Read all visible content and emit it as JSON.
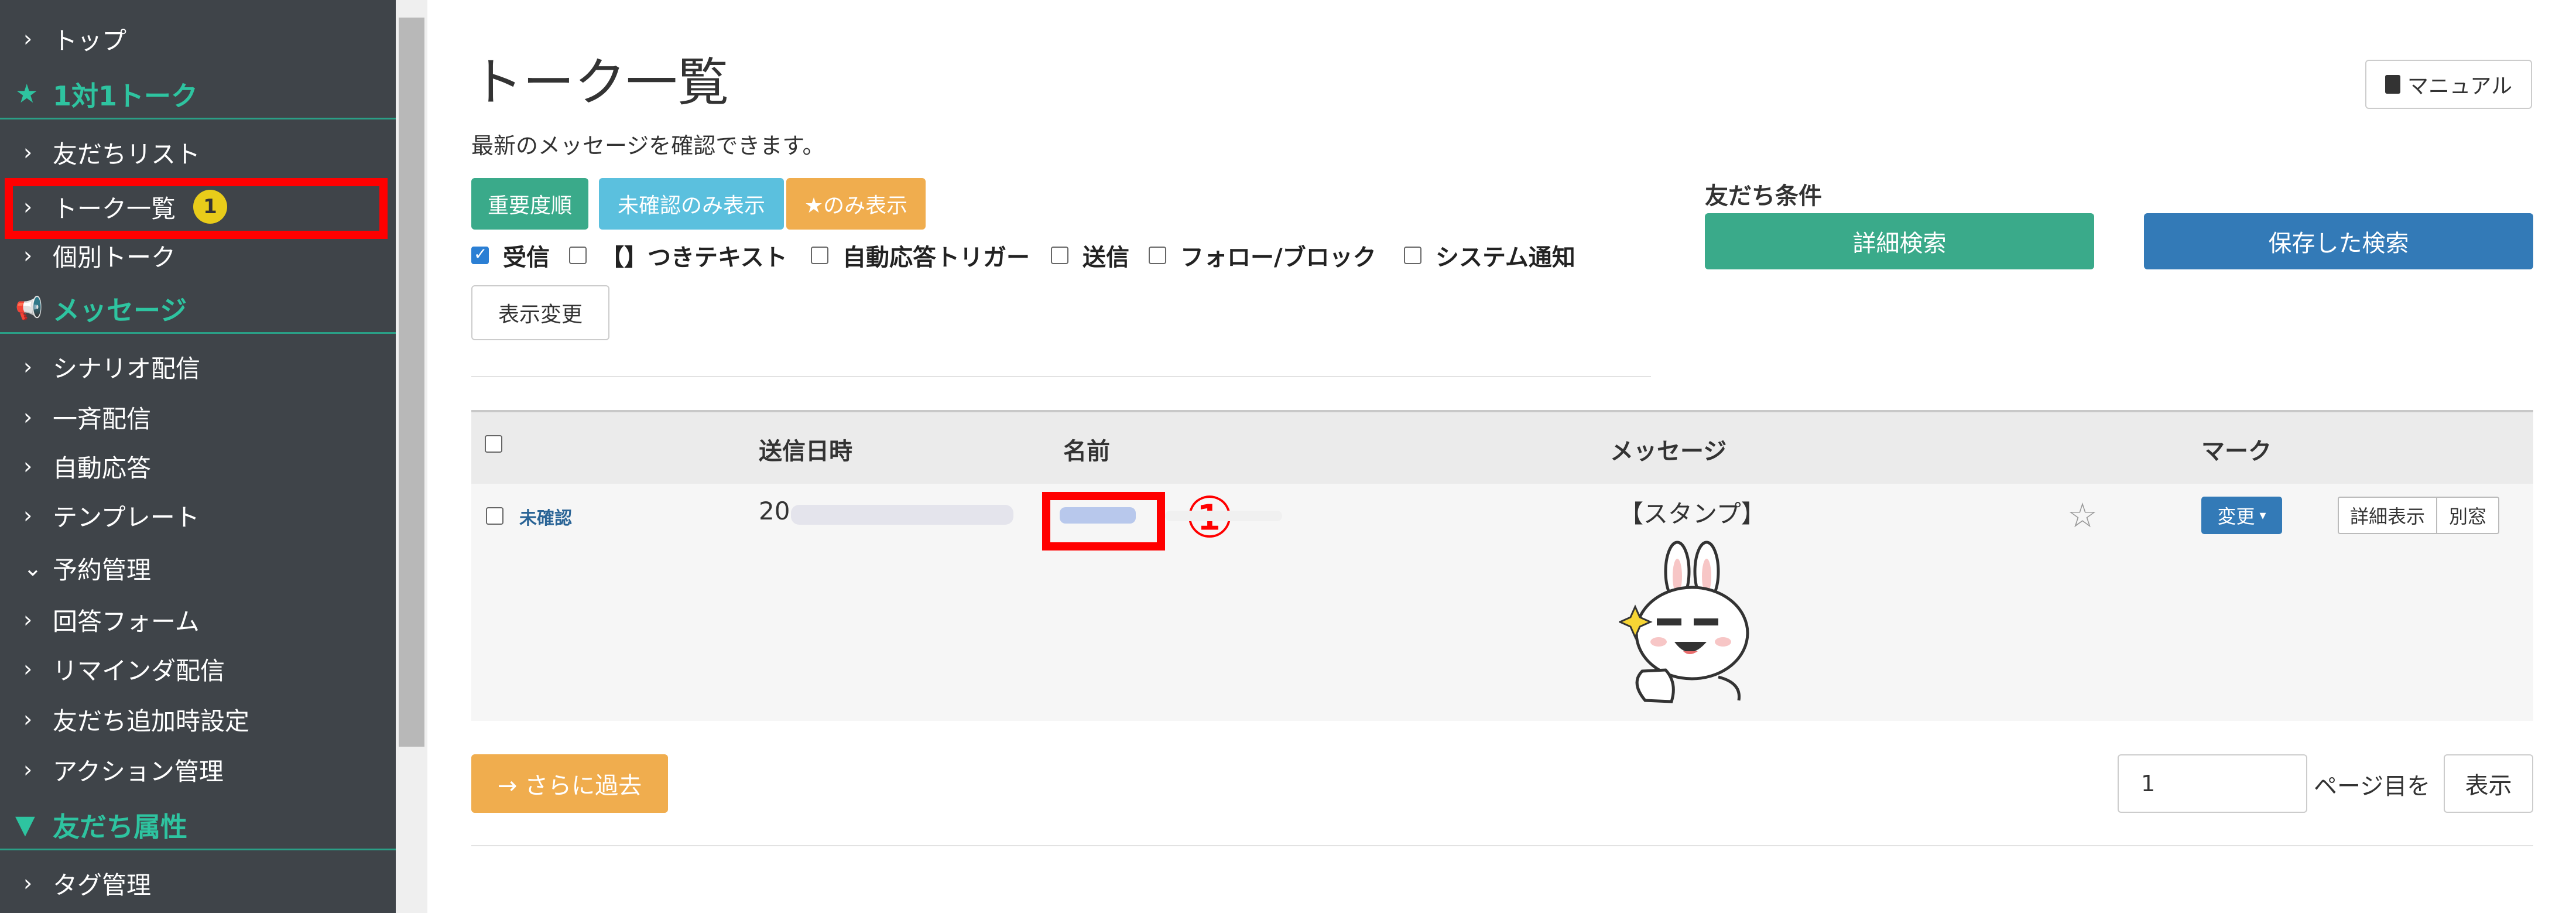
{
  "sidebar": {
    "items": [
      {
        "type": "item",
        "label": "トップ",
        "chevron": "›"
      },
      {
        "type": "section",
        "label": "1対1トーク",
        "icon": "★"
      },
      {
        "type": "item",
        "label": "友だちリスト",
        "chevron": "›"
      },
      {
        "type": "item",
        "label": "トーク一覧",
        "chevron": "›",
        "badge": "1"
      },
      {
        "type": "item",
        "label": "個別トーク",
        "chevron": "›"
      },
      {
        "type": "section",
        "label": "メッセージ",
        "icon": "📢"
      },
      {
        "type": "item",
        "label": "シナリオ配信",
        "chevron": "›"
      },
      {
        "type": "item",
        "label": "一斉配信",
        "chevron": "›"
      },
      {
        "type": "item",
        "label": "自動応答",
        "chevron": "›"
      },
      {
        "type": "item",
        "label": "テンプレート",
        "chevron": "›"
      },
      {
        "type": "item",
        "label": "予約管理",
        "chevron": "⌄"
      },
      {
        "type": "item",
        "label": "回答フォーム",
        "chevron": "›"
      },
      {
        "type": "item",
        "label": "リマインダ配信",
        "chevron": "›"
      },
      {
        "type": "item",
        "label": "友だち追加時設定",
        "chevron": "›"
      },
      {
        "type": "item",
        "label": "アクション管理",
        "chevron": "›"
      },
      {
        "type": "section",
        "label": "友だち属性",
        "icon": "▼"
      },
      {
        "type": "item",
        "label": "タグ管理",
        "chevron": "›"
      }
    ]
  },
  "page": {
    "title": "トーク一覧",
    "subtitle": "最新のメッセージを確認できます。",
    "manual_label": "マニュアル"
  },
  "filters": {
    "buttons": {
      "importance": "重要度順",
      "unconfirmed_only": "未確認のみ表示",
      "star_only": "★のみ表示"
    },
    "checkboxes": [
      {
        "label": "受信",
        "checked": true
      },
      {
        "label": "【】つきテキスト",
        "checked": false
      },
      {
        "label": "自動応答トリガー",
        "checked": false
      },
      {
        "label": "送信",
        "checked": false
      },
      {
        "label": "フォロー/ブロック",
        "checked": false
      },
      {
        "label": "システム通知",
        "checked": false
      }
    ],
    "apply_label": "表示変更"
  },
  "friend_conditions": {
    "title": "友だち条件",
    "detail_search": "詳細検索",
    "saved_search": "保存した検索"
  },
  "table": {
    "headers": {
      "sent_at": "送信日時",
      "name": "名前",
      "message": "メッセージ",
      "mark": "マーク"
    },
    "rows": [
      {
        "status": "未確認",
        "sent_at_prefix": "20",
        "message": "【スタンプ】",
        "mark_button": "変更",
        "detail_button": "詳細表示",
        "window_button": "別窓"
      }
    ]
  },
  "annotation": {
    "marker": "①"
  },
  "pagination": {
    "older_label": "→ さらに過去",
    "page_value": "1",
    "page_suffix": "ページ目を",
    "show_label": "表示"
  },
  "colors": {
    "sidebar_bg": "#3f4449",
    "accent_teal": "#2ec4a0",
    "btn_green": "#3aaa8a",
    "btn_cyan": "#5bc0de",
    "btn_orange": "#f0ad4e",
    "btn_blue": "#337ab7",
    "highlight_red": "#ff0000"
  }
}
